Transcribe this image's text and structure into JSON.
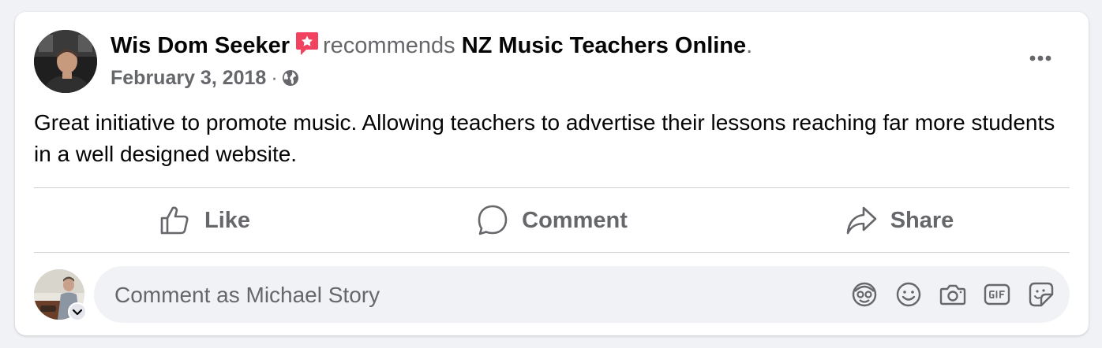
{
  "post": {
    "author": "Wis Dom Seeker",
    "verb": "recommends",
    "page_name": "NZ Music Teachers Online",
    "period": ".",
    "date": "February 3, 2018",
    "separator": "·",
    "audience_icon": "globe-icon",
    "text": "Great initiative to promote music. Allowing teachers to advertise their lessons reaching far more students in a well designed website."
  },
  "actions": {
    "like_label": "Like",
    "comment_label": "Comment",
    "share_label": "Share"
  },
  "composer": {
    "placeholder": "Comment as Michael Story",
    "tools": [
      "avatar-sticker-icon",
      "emoji-icon",
      "camera-icon",
      "gif-icon",
      "sticker-icon"
    ]
  },
  "colors": {
    "recommend_badge": "#f3425f",
    "secondary_text": "#65676b",
    "primary_text": "#050505",
    "divider": "#ced0d4",
    "composer_bg": "#f0f2f5"
  }
}
